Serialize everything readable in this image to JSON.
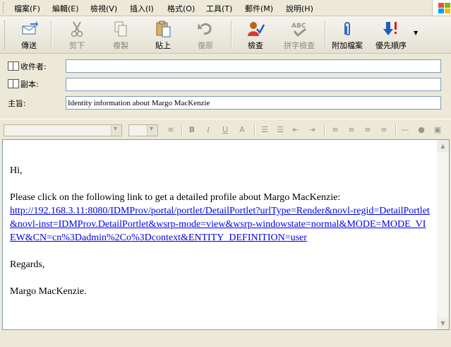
{
  "menu": {
    "items": [
      "檔案(F)",
      "編輯(E)",
      "檢視(V)",
      "插入(I)",
      "格式(O)",
      "工具(T)",
      "郵件(M)",
      "說明(H)"
    ]
  },
  "toolbar": {
    "send": "傳送",
    "cut": "剪下",
    "copy": "複製",
    "paste": "貼上",
    "undo": "復原",
    "check": "檢查",
    "spelling": "拼字檢查",
    "attach": "附加檔案",
    "priority": "優先順序"
  },
  "header": {
    "to_label": "收件者:",
    "to_value": "",
    "cc_label": "副本:",
    "cc_value": "",
    "subject_label": "主旨:",
    "subject_value": "Identity information about Margo MacKenzie"
  },
  "body": {
    "greeting": "Hi,",
    "intro": "Please click on the following link to get a detailed profile about Margo MacKenzie:",
    "link": "http://192.168.3.11:8080/IDMProv/portal/portlet/DetailPortlet?urlType=Render&novl-regid=DetailPortlet&novl-inst=IDMProv.DetailPortlet&wsrp-mode=view&wsrp-windowstate=normal&MODE=MODE_VIEW&CN=cn%3Dadmin%2Co%3Dcontext&ENTITY_DEFINITION=user",
    "closing": "Regards,",
    "signature": "Margo MacKenzie."
  },
  "colors": {
    "link": "#0000ee",
    "chrome": "#ece9d8",
    "field_border": "#7f9db9"
  }
}
